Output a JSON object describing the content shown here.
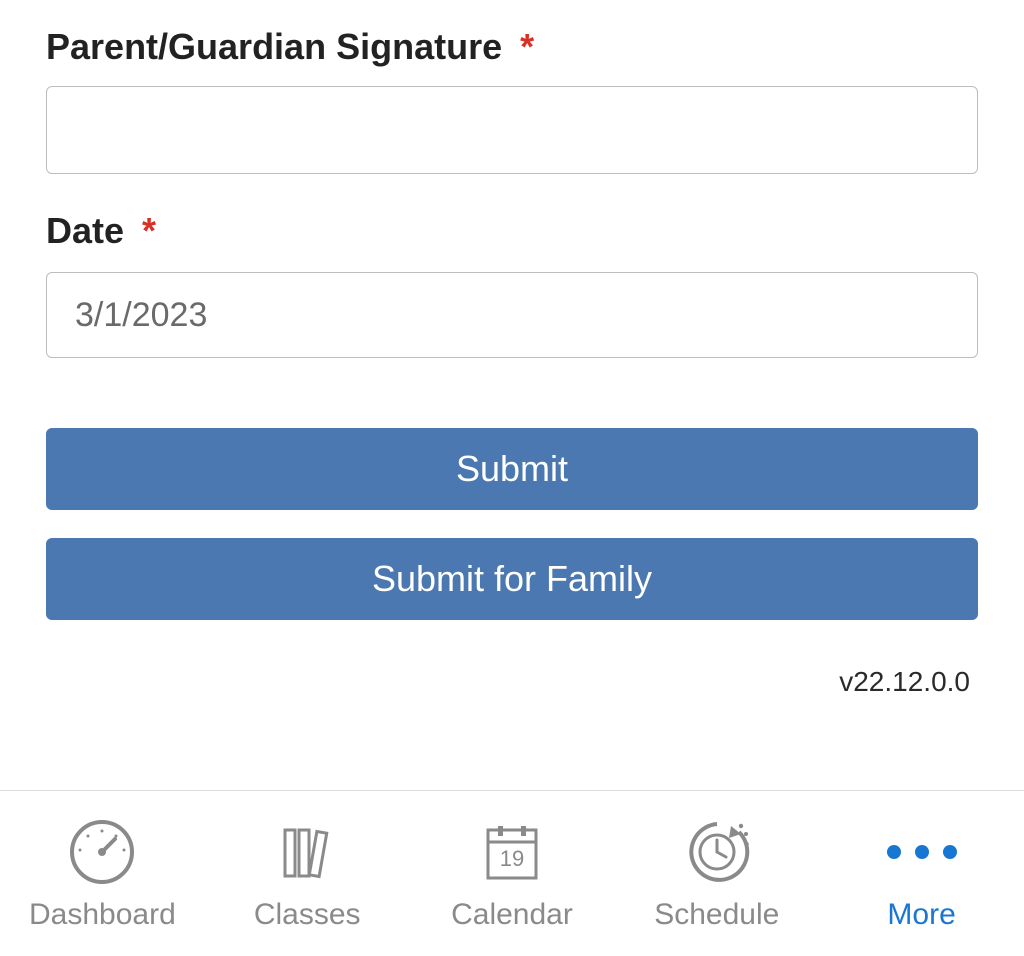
{
  "form": {
    "signature_label": "Parent/Guardian Signature",
    "signature_value": "",
    "date_label": "Date",
    "date_value": "3/1/2023",
    "required_mark": "*"
  },
  "buttons": {
    "submit": "Submit",
    "submit_family": "Submit for Family"
  },
  "version": "v22.12.0.0",
  "tabs": {
    "dashboard": "Dashboard",
    "classes": "Classes",
    "calendar": "Calendar",
    "calendar_day": "19",
    "schedule": "Schedule",
    "more": "More"
  }
}
